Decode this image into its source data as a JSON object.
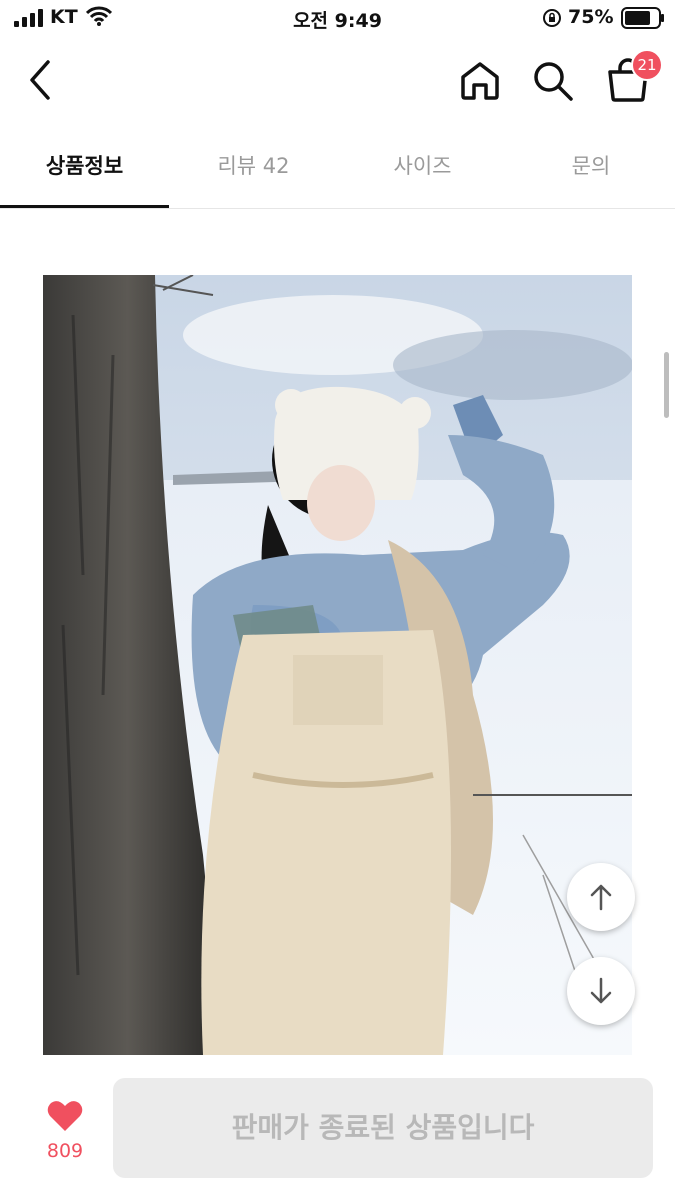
{
  "status_bar": {
    "carrier": "KT",
    "time": "오전 9:49",
    "battery_percent": "75%",
    "battery_level": 0.75
  },
  "nav": {
    "cart_count": "21",
    "icons": [
      "back-icon",
      "home-icon",
      "search-icon",
      "cart-icon"
    ]
  },
  "tabs": [
    {
      "label": "상품정보",
      "active": true
    },
    {
      "label": "리뷰 42",
      "active": false
    },
    {
      "label": "사이즈",
      "active": false
    },
    {
      "label": "문의",
      "active": false
    }
  ],
  "product": {
    "image_icon": "product-photo"
  },
  "footer": {
    "like_count": "809",
    "status_label": "판매가 종료된 상품입니다"
  },
  "colors": {
    "accent": "#f0505f",
    "disabled_bg": "#ebebeb",
    "disabled_text": "#b8b8b8"
  }
}
